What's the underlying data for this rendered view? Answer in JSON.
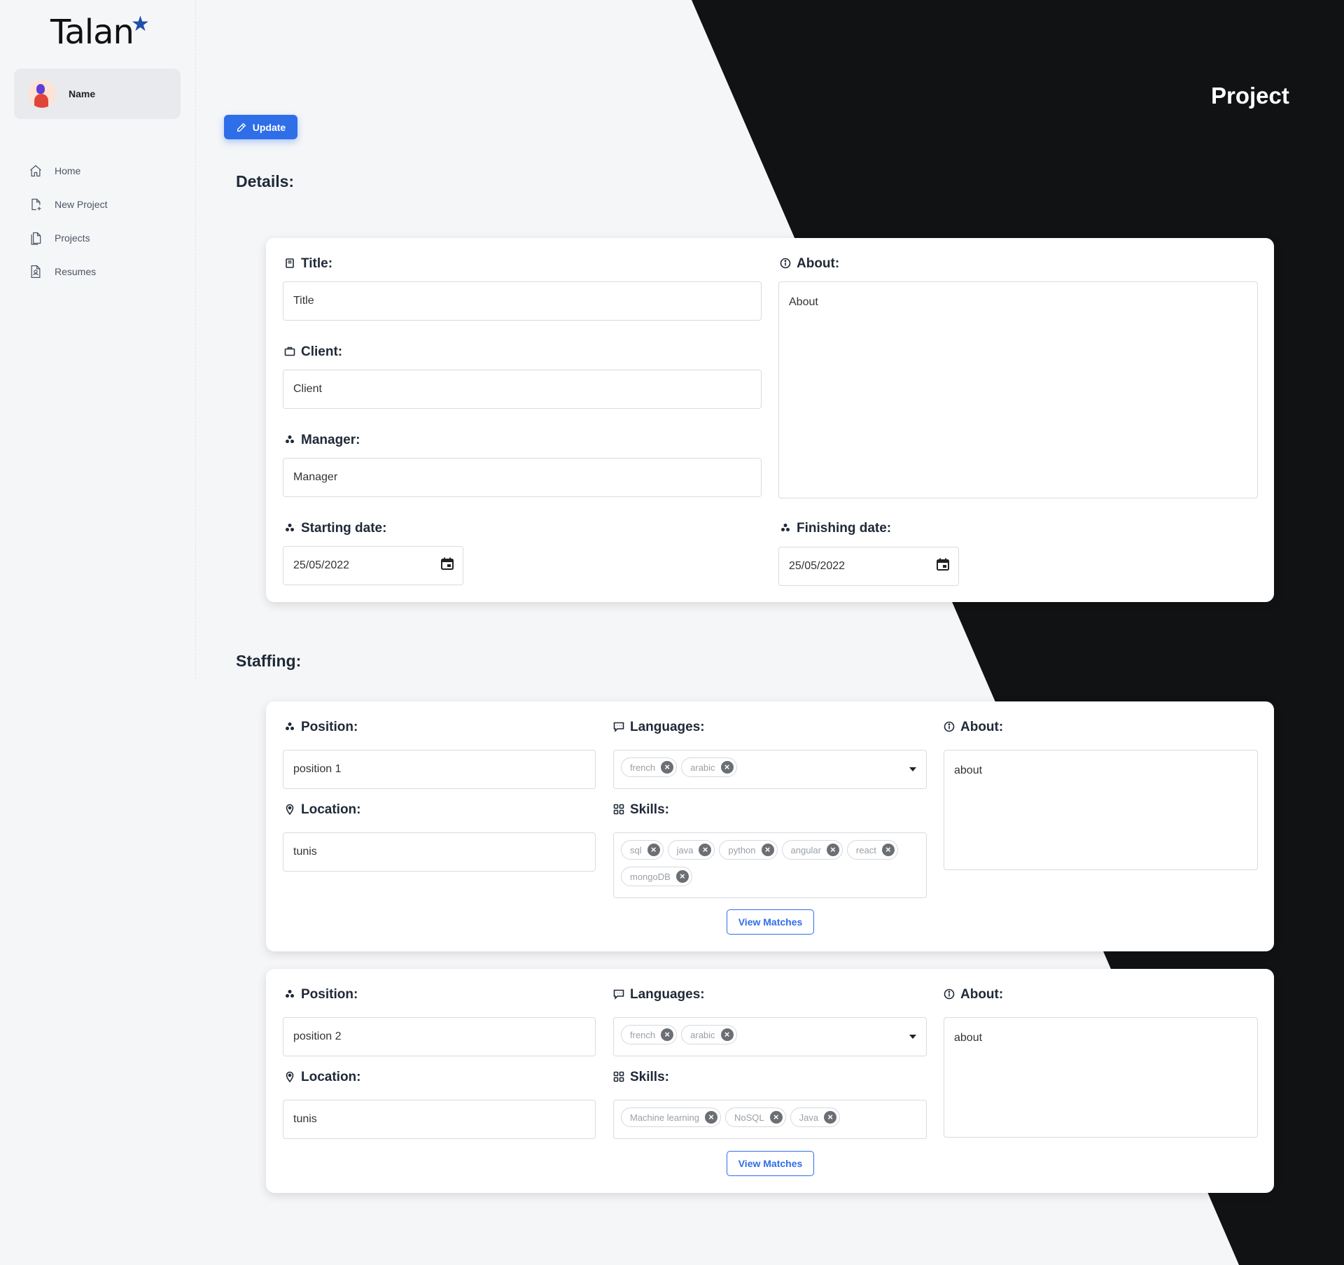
{
  "app": {
    "logo_text": "Talan"
  },
  "profile": {
    "name": "Name"
  },
  "nav": [
    {
      "label": "Home",
      "icon": "home-icon"
    },
    {
      "label": "New Project",
      "icon": "new-file-icon"
    },
    {
      "label": "Projects",
      "icon": "files-icon"
    },
    {
      "label": "Resumes",
      "icon": "resume-icon"
    }
  ],
  "page_title": "Project",
  "update_button": "Update",
  "details": {
    "heading": "Details:",
    "title_label": "Title:",
    "title_value": "Title",
    "client_label": "Client:",
    "client_value": "Client",
    "manager_label": "Manager:",
    "manager_value": "Manager",
    "about_label": "About:",
    "about_value": "About",
    "start_label": "Starting date:",
    "start_value": "25/05/2022",
    "finish_label": "Finishing date:",
    "finish_value": "25/05/2022"
  },
  "staffing": {
    "heading": "Staffing:",
    "labels": {
      "position": "Position:",
      "languages": "Languages:",
      "about": "About:",
      "location": "Location:",
      "skills": "Skills:",
      "view_matches": "View Matches"
    },
    "positions": [
      {
        "position": "position 1",
        "location": "tunis",
        "about": "about",
        "languages": [
          "french",
          "arabic"
        ],
        "skills": [
          "sql",
          "java",
          "python",
          "angular",
          "react",
          "mongoDB"
        ]
      },
      {
        "position": "position 2",
        "location": "tunis",
        "about": "about",
        "languages": [
          "french",
          "arabic"
        ],
        "skills": [
          "Machine learning",
          "NoSQL",
          "Java"
        ]
      }
    ]
  },
  "colors": {
    "accent": "#2f6ee9",
    "dark_bg": "#111214",
    "page_bg": "#f5f6f8"
  }
}
